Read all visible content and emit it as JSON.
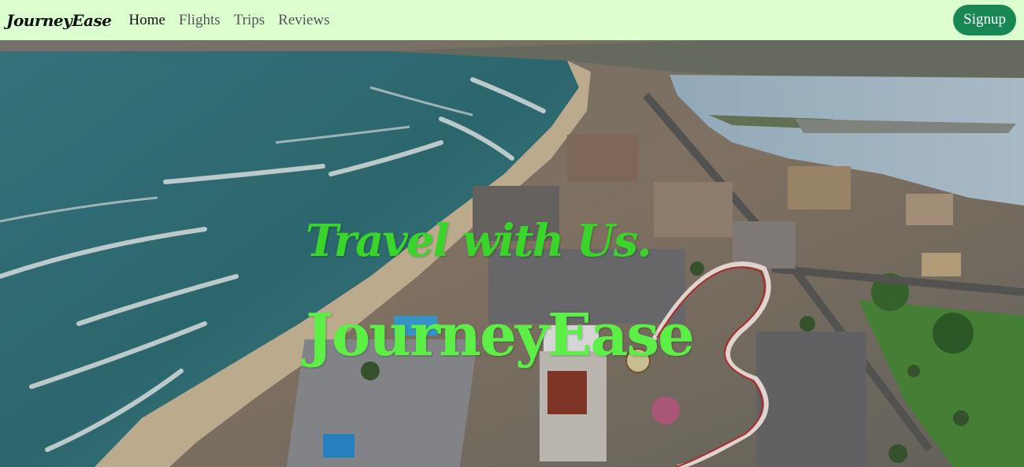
{
  "navbar": {
    "brand": "JourneyEase",
    "links": [
      "Home",
      "Flights",
      "Trips",
      "Reviews"
    ],
    "active_link": "Home",
    "signup_label": "Signup"
  },
  "hero": {
    "tagline": "Travel with Us.",
    "title": "JourneyEase",
    "background": "aerial-coastal-city-photo"
  },
  "colors": {
    "navbar_bg": "#dcffd0",
    "signup_bg": "#198754",
    "tagline": "#3ad52a",
    "title": "#5cf047"
  }
}
